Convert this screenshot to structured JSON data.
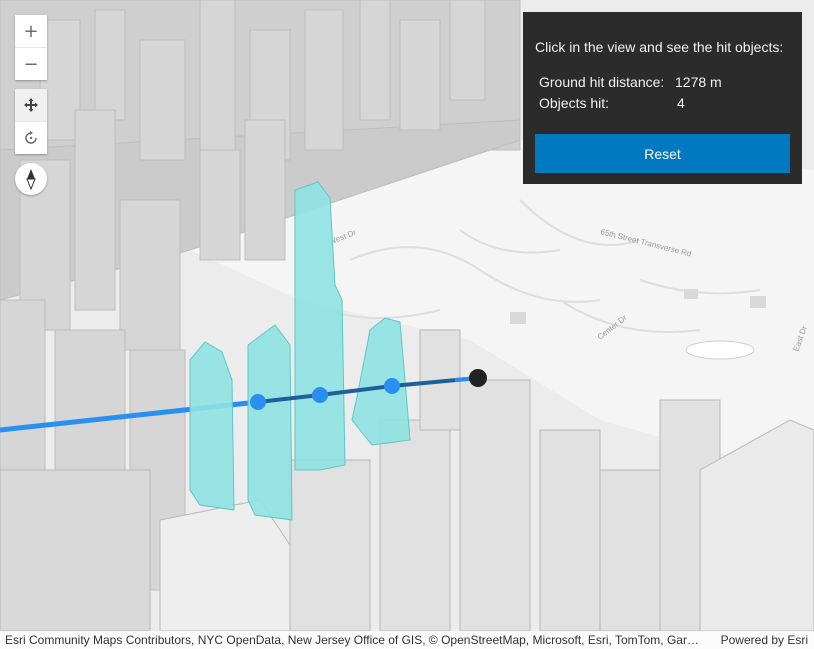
{
  "map": {
    "street_labels": [
      "West Dr",
      "65th Street Transverse Rd",
      "Center Dr",
      "East Dr"
    ]
  },
  "controls": {
    "zoom_in": "+",
    "zoom_out": "−",
    "pan_icon": "pan-icon",
    "rotate_icon": "rotate-icon",
    "compass_icon": "compass-icon"
  },
  "panel": {
    "title": "Click in the view and see the hit objects:",
    "ground_hit_label": "Ground hit distance:",
    "ground_hit_value": "1278 m",
    "objects_hit_label": "Objects hit:",
    "objects_hit_value": "4",
    "reset_label": "Reset"
  },
  "attribution": {
    "text": "Esri Community Maps Contributors, NYC OpenData, New Jersey Office of GIS, © OpenStreetMap, Microsoft, Esri, TomTom, Garmin, SafeGraph, GeoTechnologies, Inc, METI/NASA, USGS, EPA, NPS, US Census Bureau, USDA, USFWS",
    "powered": "Powered by Esri"
  },
  "colors": {
    "highlight_building": "#8fe3e3",
    "ray_line": "#2a8ff0",
    "ray_line_dark": "#1f5f9a",
    "panel_bg": "#2b2b2b",
    "button": "#0079c1"
  }
}
